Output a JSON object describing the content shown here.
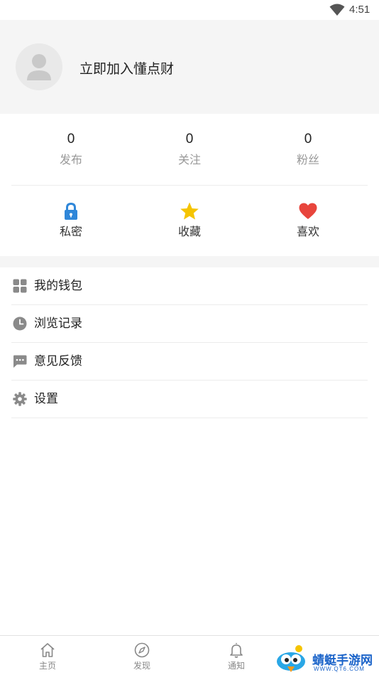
{
  "status": {
    "time": "4:51",
    "wifi_icon": "wifi-icon"
  },
  "profile": {
    "join_label": "立即加入懂点财",
    "avatar_icon": "person-icon"
  },
  "stats": [
    {
      "value": "0",
      "label": "发布"
    },
    {
      "value": "0",
      "label": "关注"
    },
    {
      "value": "0",
      "label": "粉丝"
    }
  ],
  "quick_actions": [
    {
      "label": "私密",
      "icon": "lock-icon",
      "color": "#2f87d9"
    },
    {
      "label": "收藏",
      "icon": "star-icon",
      "color": "#f5c400"
    },
    {
      "label": "喜欢",
      "icon": "heart-icon",
      "color": "#e8453c"
    }
  ],
  "menu": [
    {
      "label": "我的钱包",
      "icon": "grid-icon"
    },
    {
      "label": "浏览记录",
      "icon": "clock-icon"
    },
    {
      "label": "意见反馈",
      "icon": "chat-icon"
    },
    {
      "label": "设置",
      "icon": "gear-icon"
    }
  ],
  "tabbar": [
    {
      "label": "主页",
      "icon": "home-icon"
    },
    {
      "label": "发现",
      "icon": "compass-icon"
    },
    {
      "label": "通知",
      "icon": "bell-icon"
    }
  ],
  "watermark": {
    "title": "蜻蜓手游网",
    "subtitle": "WWW.QT6.COM"
  },
  "colors": {
    "icon_gray": "#888888",
    "accent_blue": "#2f87d9"
  }
}
